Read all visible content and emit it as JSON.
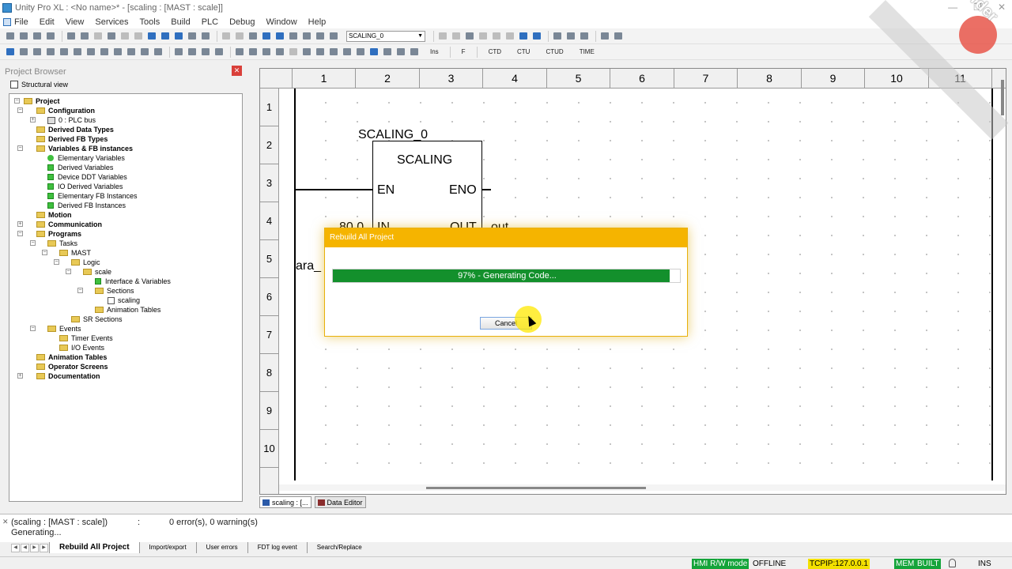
{
  "window": {
    "title": "Unity Pro XL : <No name>* - [scaling : [MAST : scale]]",
    "buttons": [
      "—",
      "❐",
      "✕"
    ]
  },
  "menu": [
    "File",
    "Edit",
    "View",
    "Services",
    "Tools",
    "Build",
    "PLC",
    "Debug",
    "Window",
    "Help"
  ],
  "toolbar": {
    "instance_combo": "SCALING_0",
    "fb_buttons": [
      "CTD",
      "CTU",
      "CTUD",
      "TIME"
    ],
    "ins_label": "Ins",
    "f_label": "F"
  },
  "project_browser": {
    "title": "Project Browser",
    "view_label": "Structural view",
    "tree": [
      {
        "label": "Project",
        "bold": true
      },
      {
        "label": "Configuration",
        "bold": true
      },
      {
        "label": "0 : PLC bus",
        "bold": false
      },
      {
        "label": "Derived Data Types",
        "bold": true
      },
      {
        "label": "Derived FB Types",
        "bold": true
      },
      {
        "label": "Variables & FB instances",
        "bold": true
      },
      {
        "label": "Elementary Variables",
        "bold": false
      },
      {
        "label": "Derived Variables",
        "bold": false
      },
      {
        "label": "Device DDT Variables",
        "bold": false
      },
      {
        "label": "IO Derived Variables",
        "bold": false
      },
      {
        "label": "Elementary FB Instances",
        "bold": false
      },
      {
        "label": "Derived FB Instances",
        "bold": false
      },
      {
        "label": "Motion",
        "bold": true
      },
      {
        "label": "Communication",
        "bold": true
      },
      {
        "label": "Programs",
        "bold": true
      },
      {
        "label": "Tasks",
        "bold": false
      },
      {
        "label": "MAST",
        "bold": false
      },
      {
        "label": "Logic",
        "bold": false
      },
      {
        "label": "scale",
        "bold": false
      },
      {
        "label": "Interface & Variables",
        "bold": false
      },
      {
        "label": "Sections",
        "bold": false
      },
      {
        "label": "scaling",
        "bold": false
      },
      {
        "label": "Animation Tables",
        "bold": false
      },
      {
        "label": "SR Sections",
        "bold": false
      },
      {
        "label": "Events",
        "bold": false
      },
      {
        "label": "Timer Events",
        "bold": false
      },
      {
        "label": "I/O Events",
        "bold": false
      },
      {
        "label": "Animation Tables",
        "bold": true
      },
      {
        "label": "Operator Screens",
        "bold": true
      },
      {
        "label": "Documentation",
        "bold": true
      }
    ]
  },
  "editor": {
    "columns": [
      "1",
      "2",
      "3",
      "4",
      "5",
      "6",
      "7",
      "8",
      "9",
      "10",
      "11"
    ],
    "rows": [
      "1",
      "2",
      "3",
      "4",
      "5",
      "6",
      "7",
      "8",
      "9",
      "10"
    ],
    "fb_instance": "SCALING_0",
    "fb_type": "SCALING",
    "pin_en": "EN",
    "pin_eno": "ENO",
    "pin_in": "IN",
    "pin_out": "OUT",
    "input_value": "80.0",
    "output_var": "out",
    "left_var": "ara_"
  },
  "editor_tabs": [
    {
      "label": "scaling : [..."
    },
    {
      "label": "Data Editor"
    }
  ],
  "dialog": {
    "title": "Rebuild All Project",
    "progress_percent": 97,
    "progress_text": "97% - Generating Code...",
    "cancel_label": "Cancel"
  },
  "output": {
    "line1_section": "(scaling : [MAST : scale])",
    "line1_sep": ":",
    "line1_result": "0 error(s), 0 warning(s)",
    "line2": "Generating..."
  },
  "output_tabs": [
    "Rebuild All Project",
    "Import/export",
    "User errors",
    "FDT log event",
    "Search/Replace"
  ],
  "status": {
    "hmi": "HMI R/W mode",
    "mode": "OFFLINE",
    "address": "TCPIP:127.0.0.1",
    "mem": "MEM",
    "built": "BUILT",
    "ins": "INS"
  },
  "watermark": {
    "text": "iTop Screen Recorder"
  },
  "colors": {
    "progress": "#13902c",
    "dialog_header": "#f5b400",
    "status_green": "#14a43a",
    "status_yellow": "#f3e000"
  }
}
